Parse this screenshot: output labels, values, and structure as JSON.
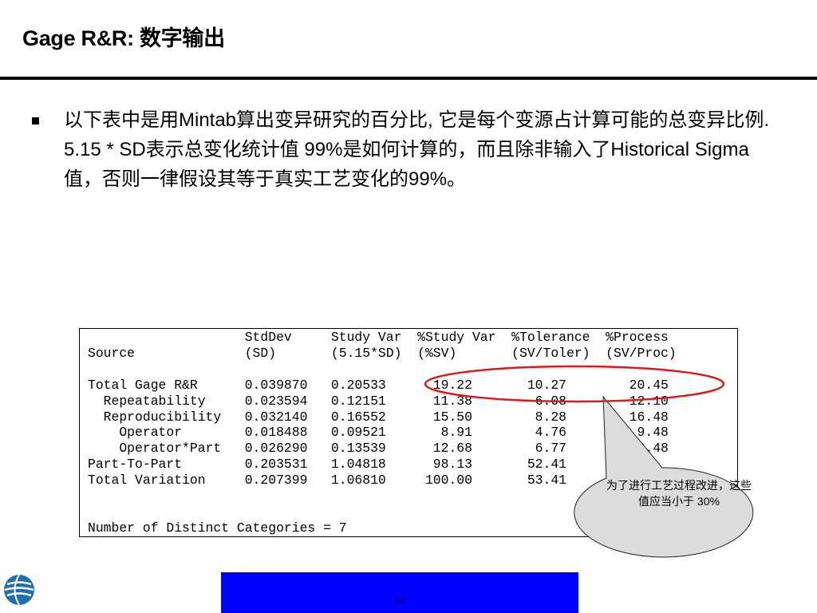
{
  "slide": {
    "title": "Gage R&R: 数字输出",
    "bullet": "以下表中是用Mintab算出变异研究的百分比, 它是每个变源占计算可能的总变异比例. 5.15 * SD表示总变化统计值 99%是如何计算的，而且除非输入了Historical Sigma 值，否则一律假设其等于真实工艺变化的99%。",
    "page_number": "24"
  },
  "output_lines": [
    "                    StdDev     Study Var  %Study Var  %Tolerance  %Process",
    "Source              (SD)       (5.15*SD)  (%SV)       (SV/Toler)  (SV/Proc)",
    "",
    "Total Gage R&R      0.039870   0.20533      19.22       10.27        20.45",
    "  Repeatability     0.023594   0.12151      11.38        6.08        12.10",
    "  Reproducibility   0.032140   0.16552      15.50        8.28        16.48",
    "    Operator        0.018488   0.09521       8.91        4.76         9.48",
    "    Operator*Part   0.026290   0.13539      12.68        6.77        13.48",
    "Part-To-Part        0.203531   1.04818      98.13       52.41",
    "Total Variation     0.207399   1.06810     100.00       53.41",
    "",
    "",
    "Number of Distinct Categories = 7"
  ],
  "callout": {
    "text": "为了进行工艺过程改进，这些值应当小于 30%"
  },
  "colors": {
    "ellipse": "#d81c1c",
    "callout_fill": "#dcdcdc",
    "footer_bar": "#0000ff",
    "logo": "#1f6fb2"
  },
  "icons": {
    "logo": "company-globe-logo"
  }
}
